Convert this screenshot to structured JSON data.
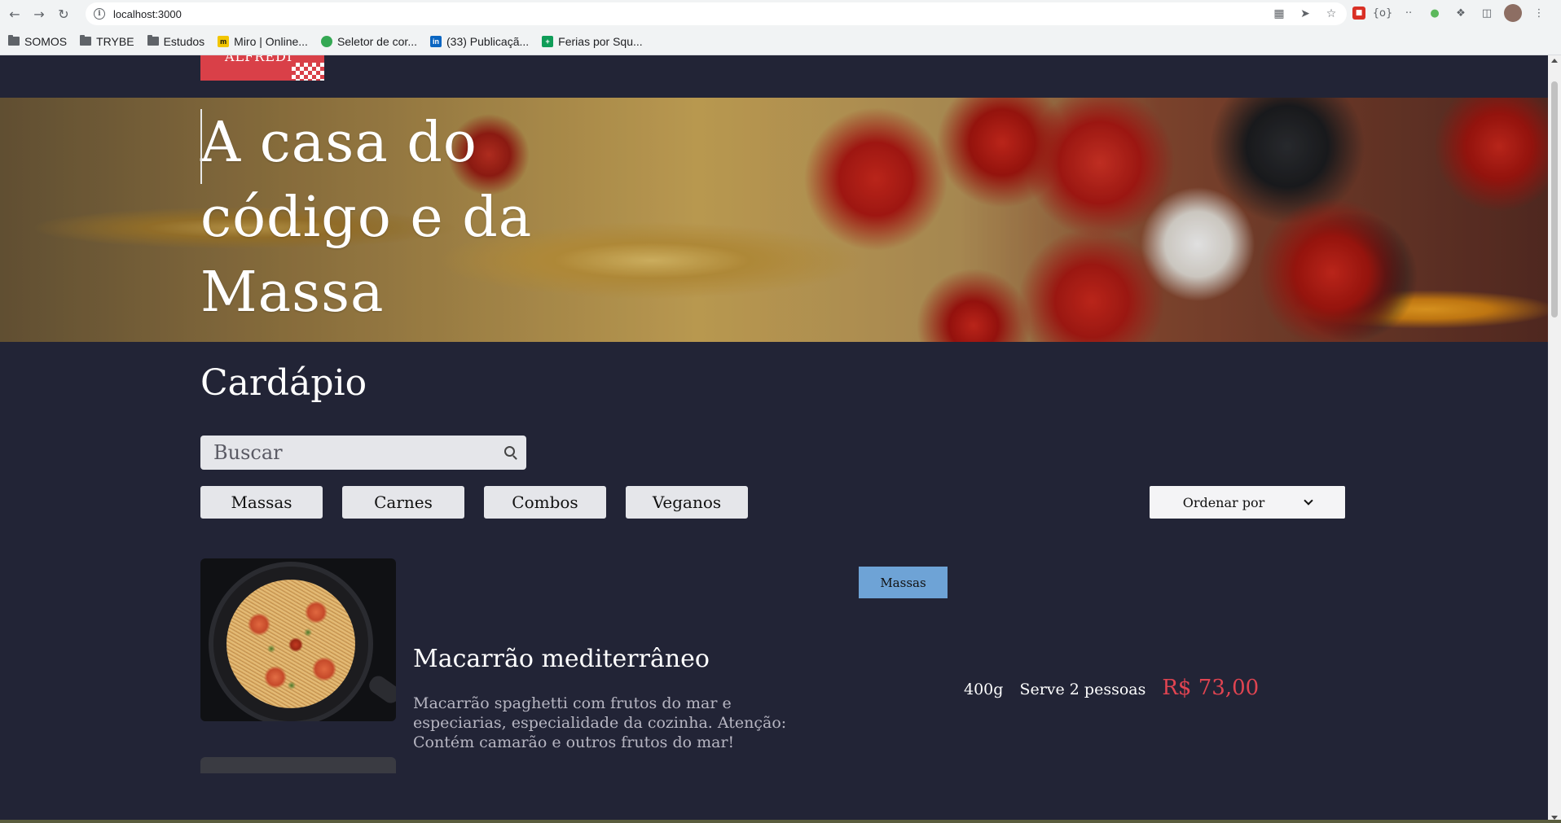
{
  "browser": {
    "url": "localhost:3000",
    "bookmarks": [
      {
        "label": "SOMOS",
        "type": "folder"
      },
      {
        "label": "TRYBE",
        "type": "folder"
      },
      {
        "label": "Estudos",
        "type": "folder"
      },
      {
        "label": "Miro | Online...",
        "type": "site",
        "color": "#f2c500"
      },
      {
        "label": "Seletor de cor...",
        "type": "site",
        "color": "#1a73e8"
      },
      {
        "label": "(33) Publicaçã...",
        "type": "site",
        "color": "#0a66c2"
      },
      {
        "label": "Ferias por Squ...",
        "type": "site",
        "color": "#0f9d58"
      }
    ]
  },
  "site": {
    "logo_text": "ALFREDI",
    "hero_title": "A casa do código e da Massa",
    "menu_title": "Cardápio",
    "search_placeholder": "Buscar",
    "filters": [
      "Massas",
      "Carnes",
      "Combos",
      "Veganos"
    ],
    "sort_label": "Ordenar por"
  },
  "dish": {
    "name": "Macarrão mediterrâneo",
    "description": "Macarrão spaghetti com frutos do mar e especiarias, especialidade da cozinha. Atenção: Contém camarão e outros frutos do mar!",
    "category": "Massas",
    "weight": "400g",
    "serves": "Serve 2 pessoas",
    "price": "R$ 73,00"
  },
  "colors": {
    "background": "#222436",
    "accent_price": "#e04451",
    "badge": "#6ea3d6"
  }
}
